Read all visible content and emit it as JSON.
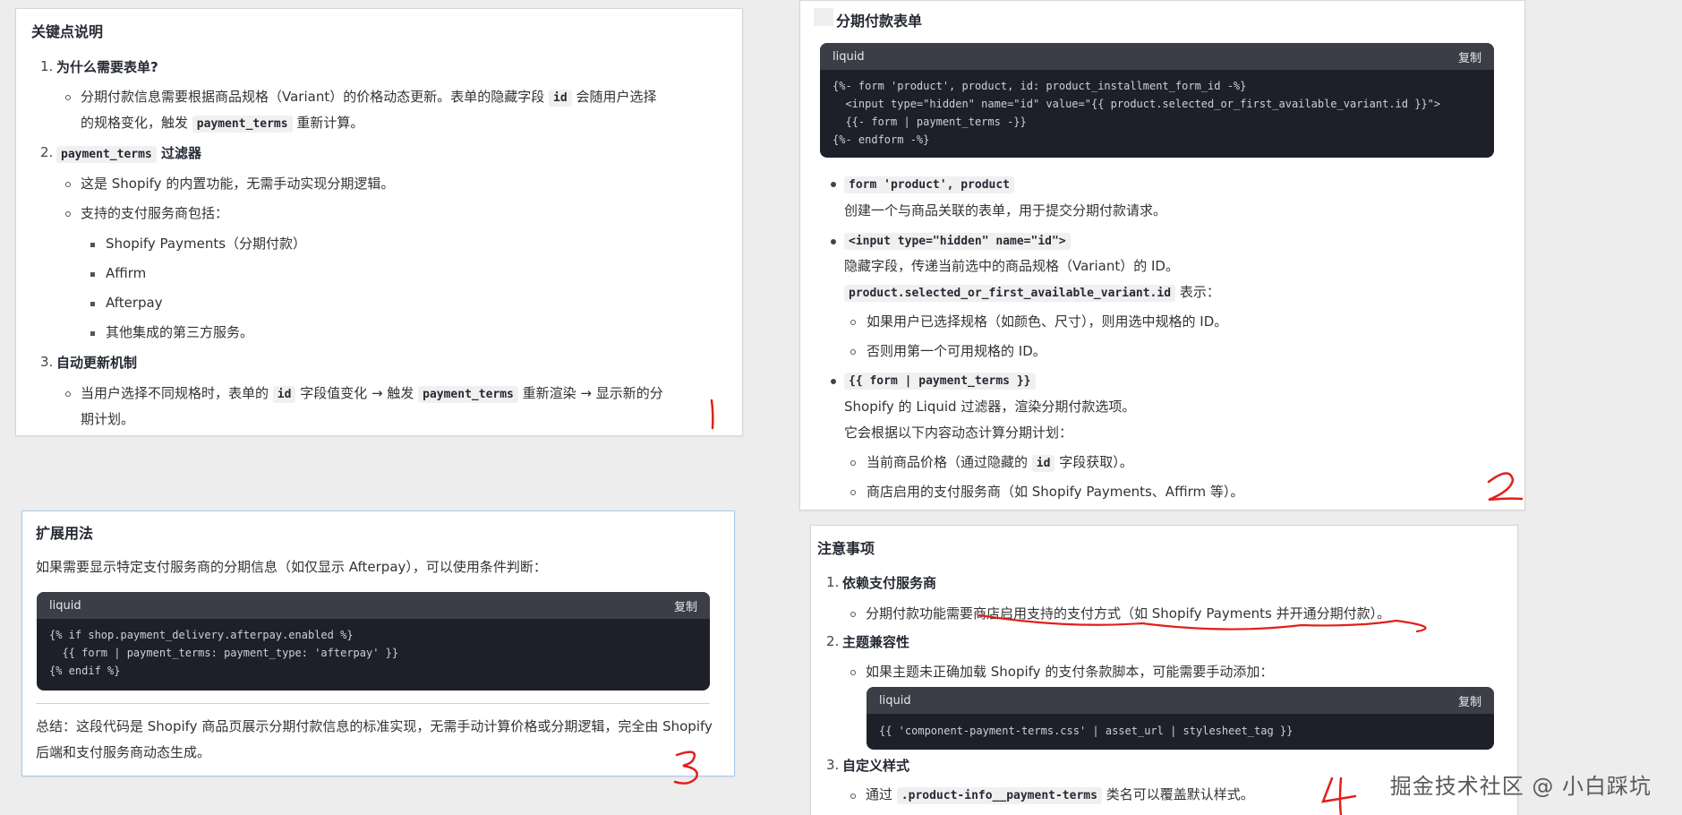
{
  "panel1": {
    "title": "关键点说明",
    "items": [
      {
        "num": "1.",
        "heading": "为什么需要表单?",
        "text": "分期付款信息需要根据商品规格（Variant）的价格动态更新。表单的隐藏字段",
        "code1": "id",
        "text2": "会随用户选择",
        "text3": "的规格变化，触发",
        "code2": "payment_terms",
        "text4": "重新计算。"
      },
      {
        "num": "2.",
        "heading_code": "payment_terms",
        "heading": "过滤器",
        "sub1": "这是 Shopify 的内置功能，无需手动实现分期逻辑。",
        "sub2": "支持的支付服务商包括：",
        "providers": [
          "Shopify Payments（分期付款）",
          "Affirm",
          "Afterpay",
          "其他集成的第三方服务。"
        ]
      },
      {
        "num": "3.",
        "heading": "自动更新机制",
        "t1": "当用户选择不同规格时，表单的",
        "c1": "id",
        "t2": "字段值变化 → 触发",
        "c2": "payment_terms",
        "t3": "重新渲染 → 显示新的分",
        "t4": "期计划。"
      }
    ]
  },
  "panel2": {
    "title": "分期付款表单",
    "code": {
      "lang": "liquid",
      "copy": "复制",
      "lines": [
        "{%- form 'product', product, id: product_installment_form_id -%}",
        "  <input type=\"hidden\" name=\"id\" value=\"{{ product.selected_or_first_available_variant.id }}\">",
        "  {{- form | payment_terms -}}",
        "{%- endform -%}"
      ]
    },
    "b1_code": "form 'product', product",
    "b1_text": "创建一个与商品关联的表单，用于提交分期付款请求。",
    "b2_code": "<input type=\"hidden\" name=\"id\">",
    "b2_text": "隐藏字段，传递当前选中的商品规格（Variant）的 ID。",
    "b2_code2": "product.selected_or_first_available_variant.id",
    "b2_text2": "表示：",
    "b2_sub1": "如果用户已选择规格（如颜色、尺寸），则用选中规格的 ID。",
    "b2_sub2": "否则用第一个可用规格的 ID。",
    "b3_code": "{{ form | payment_terms }}",
    "b3_text": "Shopify 的 Liquid 过滤器，渲染分期付款选项。",
    "b3_text2": "它会根据以下内容动态计算分期计划：",
    "b3_sub1a": "当前商品价格（通过隐藏的",
    "b3_sub1c": "id",
    "b3_sub1b": "字段获取）。",
    "b3_sub2": "商店启用的支付服务商（如 Shopify Payments、Affirm 等）。"
  },
  "panel3": {
    "title": "扩展用法",
    "intro": "如果需要显示特定支付服务商的分期信息（如仅显示 Afterpay），可以使用条件判断：",
    "code": {
      "lang": "liquid",
      "copy": "复制",
      "lines": [
        "{% if shop.payment_delivery.afterpay.enabled %}",
        "  {{ form | payment_terms: payment_type: 'afterpay' }}",
        "{% endif %}"
      ]
    },
    "summary": "总结：这段代码是 Shopify 商品页展示分期付款信息的标准实现，无需手动计算价格或分期逻辑，完全由 Shopify 后端和支付服务商动态生成。"
  },
  "panel4": {
    "title": "注意事项",
    "i1_num": "1.",
    "i1_head": "依赖支付服务商",
    "i1_text": "分期付款功能需要商店启用支持的支付方式（如 Shopify Payments 并开通分期付款）。",
    "i2_num": "2.",
    "i2_head": "主题兼容性",
    "i2_text": "如果主题未正确加载 Shopify 的支付条款脚本，可能需要手动添加：",
    "code": {
      "lang": "liquid",
      "copy": "复制",
      "line": "{{ 'component-payment-terms.css' | asset_url | stylesheet_tag }}"
    },
    "i3_num": "3.",
    "i3_head": "自定义样式",
    "i3_t1": "通过",
    "i3_code": ".product-info__payment-terms",
    "i3_t2": "类名可以覆盖默认样式。"
  },
  "annotations": {
    "a1": "1",
    "a2": "2",
    "a3": "3",
    "a4": "4",
    "color": "#e0201c"
  },
  "watermark": "掘金技术社区 @ 小白踩坑"
}
